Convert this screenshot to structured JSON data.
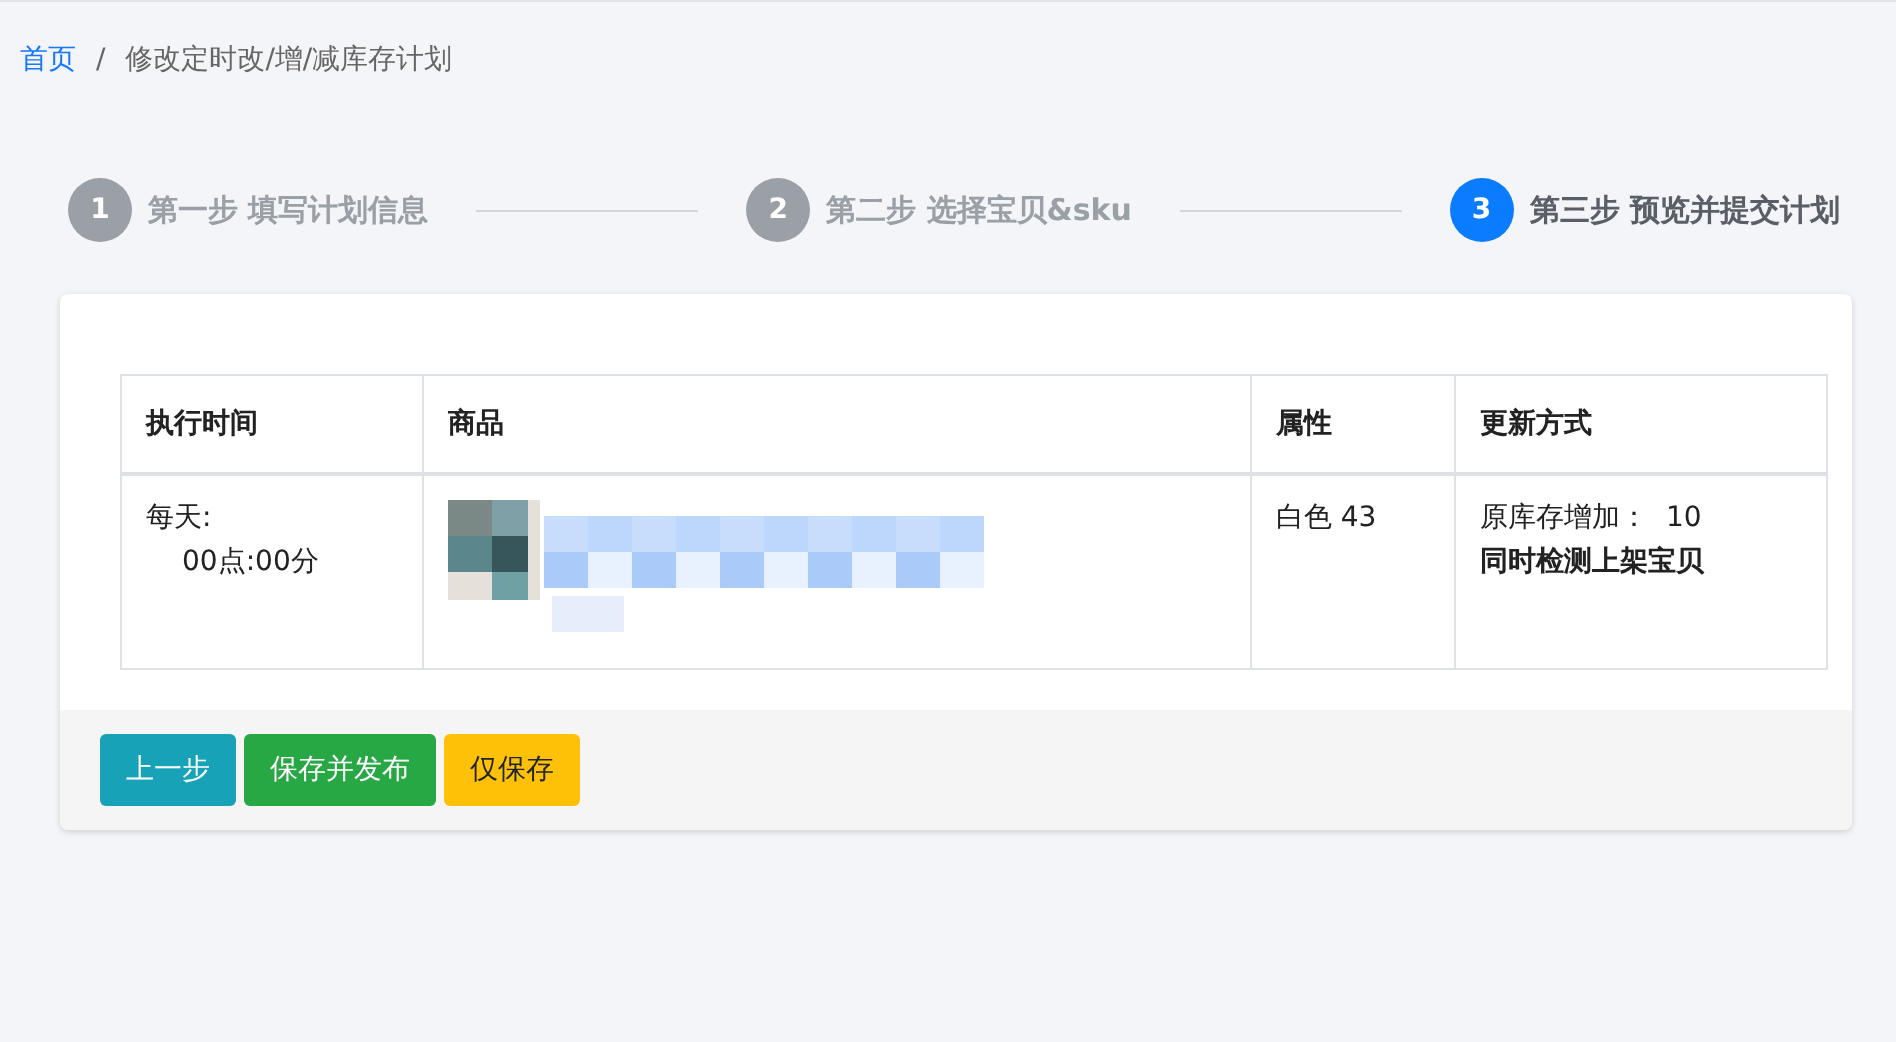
{
  "breadcrumb": {
    "home": "首页",
    "separator": "/",
    "current": "修改定时改/增/减库存计划"
  },
  "steps": [
    {
      "number": "1",
      "label": "第一步 填写计划信息",
      "selected": false
    },
    {
      "number": "2",
      "label": "第二步 选择宝贝&sku",
      "selected": false
    },
    {
      "number": "3",
      "label": "第三步 预览并提交计划",
      "selected": true
    }
  ],
  "table": {
    "columns": [
      "执行时间",
      "商品",
      "属性",
      "更新方式"
    ],
    "rows": [
      {
        "time_label": "每天:",
        "time_value": "00点:00分",
        "attribute": "白色 43",
        "update_label": "原库存增加：",
        "update_value": "10",
        "update_note": "同时检测上架宝贝"
      }
    ]
  },
  "buttons": [
    {
      "label": "上一步",
      "kind": "info"
    },
    {
      "label": "保存并发布",
      "kind": "success"
    },
    {
      "label": "仅保存",
      "kind": "warning"
    }
  ]
}
